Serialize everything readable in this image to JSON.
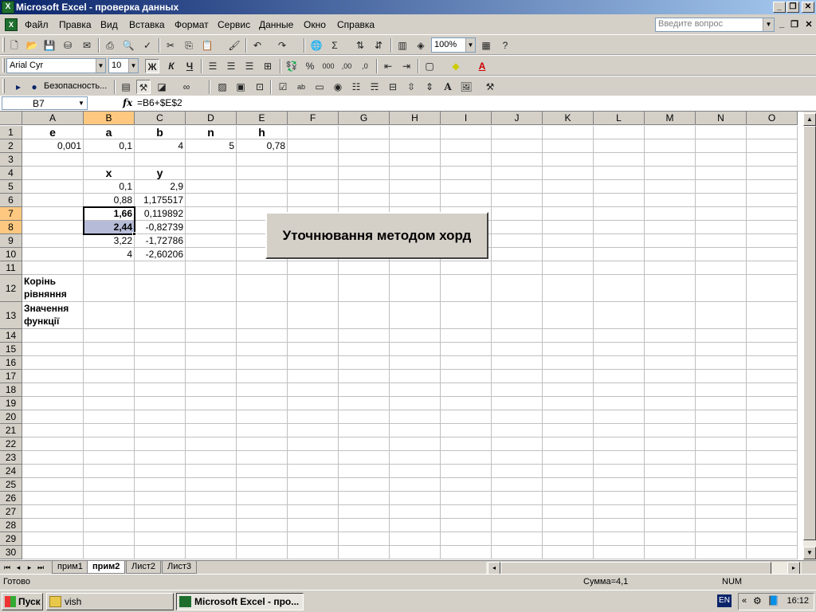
{
  "window": {
    "title": "Microsoft Excel - проверка данных"
  },
  "menu": {
    "items": [
      "Файл",
      "Правка",
      "Вид",
      "Вставка",
      "Формат",
      "Сервис",
      "Данные",
      "Окно",
      "Справка"
    ],
    "help_placeholder": "Введите вопрос"
  },
  "formatting": {
    "font": "Arial Cyr",
    "size": "10",
    "bold": "Ж",
    "italic": "К",
    "underline": "Ч"
  },
  "standard": {
    "zoom": "100%"
  },
  "security": {
    "label": "Безопасность..."
  },
  "formula_bar": {
    "cell_ref": "B7",
    "fx": "fx",
    "formula": "=B6+$E$2"
  },
  "columns": [
    "A",
    "B",
    "C",
    "D",
    "E",
    "F",
    "G",
    "H",
    "I",
    "J",
    "K",
    "L",
    "M",
    "N",
    "O"
  ],
  "rows": [
    "1",
    "2",
    "3",
    "4",
    "5",
    "6",
    "7",
    "8",
    "9",
    "10",
    "11",
    "12",
    "13",
    "14",
    "15",
    "16",
    "17",
    "18",
    "19",
    "20",
    "21",
    "22",
    "23",
    "24",
    "25",
    "26",
    "27",
    "28",
    "29",
    "30"
  ],
  "cells": {
    "A1": "e",
    "B1": "a",
    "C1": "b",
    "D1": "n",
    "E1": "h",
    "A2": "0,001",
    "B2": "0,1",
    "C2": "4",
    "D2": "5",
    "E2": "0,78",
    "B4": "x",
    "C4": "y",
    "B5": "0,1",
    "C5": "2,9",
    "B6": "0,88",
    "C6": "1,175517",
    "B7": "1,66",
    "C7": "0,119892",
    "B8": "2,44",
    "C8": "-0,82739",
    "B9": "3,22",
    "C9": "-1,72786",
    "B10": "4",
    "C10": "-2,60206",
    "A12": "Корінь рівняння",
    "A13": "Значення функції"
  },
  "macro_button": {
    "label": "Уточнювання методом хорд"
  },
  "sheets": {
    "tabs": [
      "прим1",
      "прим2",
      "Лист2",
      "Лист3"
    ],
    "active": "прим2"
  },
  "status": {
    "ready": "Готово",
    "sum": "Сумма=4,1",
    "num": "NUM"
  },
  "taskbar": {
    "start": "Пуск",
    "tasks": [
      "vish",
      "Microsoft Excel - про..."
    ],
    "lang": "EN",
    "clock": "16:12"
  }
}
